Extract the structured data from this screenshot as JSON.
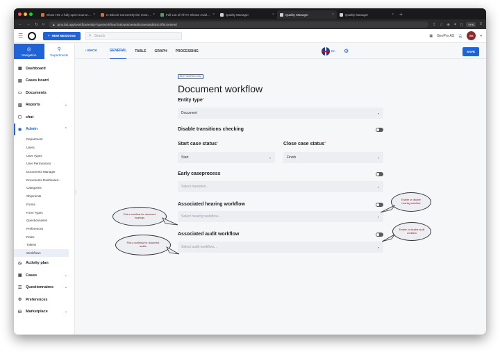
{
  "browser": {
    "tabs": [
      {
        "title": "Show HN: A fully open-source clou...",
        "color": "#e8692b",
        "active": false
      },
      {
        "title": "Is Bitcoin Concreetly the most imm...",
        "color": "#e8692b",
        "active": false
      },
      {
        "title": "Full List of All TV Shows Available...",
        "color": "#3aaa5b",
        "active": false
      },
      {
        "title": "Quality Manager",
        "color": "#cfcfcf",
        "active": false
      },
      {
        "title": "Quality Manager",
        "color": "#cfcfcf",
        "active": true
      },
      {
        "title": "Quality Manager",
        "color": "#cfcfcf",
        "active": false
      }
    ],
    "new_tab": "+",
    "url": "qms.lab.app/workflow/entityType/workflow/2580a56/ae8a8b4/ae8a8d8b4c0ff5c0e5e9d",
    "vpn": "VPN"
  },
  "topbar": {
    "new_message": "NEW MESSAGE",
    "search_placeholder": "Search",
    "org": "GeoPro AS",
    "avatar_initials": "EK"
  },
  "sidebar": {
    "tabs": [
      {
        "label": "Navigation",
        "icon": "◎",
        "active": true
      },
      {
        "label": "Departments",
        "icon": "⚲",
        "active": false
      }
    ],
    "items_top": [
      {
        "label": "Dashboard",
        "icon": "▦"
      },
      {
        "label": "Cases board",
        "icon": "▤"
      },
      {
        "label": "Documents",
        "icon": "▭"
      },
      {
        "label": "Reports",
        "icon": "▥",
        "chevron": "⌄"
      },
      {
        "label": "chat",
        "icon": "◻"
      },
      {
        "label": "Admin",
        "icon": "◉",
        "chevron": "⌃",
        "open": true
      }
    ],
    "admin_subitems": [
      "Department",
      "Users",
      "User Types",
      "User Permissions",
      "Documents Manager",
      "Documents Dashboard...",
      "Categories",
      "Shipments",
      "Forms",
      "Form Types",
      "Questionnaires",
      "Preferences",
      "Roles",
      "Tokens",
      "Workflows"
    ],
    "selected_sub": "Workflows",
    "items_bottom": [
      {
        "label": "Activity plan",
        "icon": "◷"
      },
      {
        "label": "Cases",
        "icon": "▣",
        "chevron": "⌄"
      },
      {
        "label": "Questionnaires",
        "icon": "☰",
        "chevron": "⌄"
      },
      {
        "label": "Preferences",
        "icon": "⚙"
      },
      {
        "label": "Marketplace",
        "icon": "⛁",
        "chevron": "⌄"
      }
    ]
  },
  "content_header": {
    "back": "BACK",
    "tabs": [
      "GENERAL",
      "TABLE",
      "GRAPH",
      "PROCESSING"
    ],
    "active_tab": "GENERAL",
    "lang": "En",
    "save": "SAVE"
  },
  "form": {
    "edit_tag": "EDIT WORKFLOW",
    "title": "Document workflow",
    "entity_type": {
      "label": "Entity type",
      "required": "*",
      "value": "Document"
    },
    "disable_transitions": {
      "label": "Disable transitions checking"
    },
    "start_status": {
      "label": "Start case status",
      "required": "*",
      "value": "Start"
    },
    "close_status": {
      "label": "Close case status",
      "required": "*",
      "value": "Finish"
    },
    "early_caseprocess": {
      "label": "Early caseprocess",
      "placeholder": "Select transition..."
    },
    "hearing_workflow": {
      "label": "Associated hearing workflow",
      "placeholder": "Select hearing workflow..."
    },
    "audit_workflow": {
      "label": "Associated audit workflow",
      "placeholder": "Select audit workflow..."
    }
  },
  "callouts": {
    "hearing_enable": "Enable or disable hearing workflow",
    "audit_enable": "Enable or disable audit workflow",
    "hearing_pick": "Pick a workflow for document hearings",
    "audit_pick": "Pick a workflow for document audits"
  }
}
